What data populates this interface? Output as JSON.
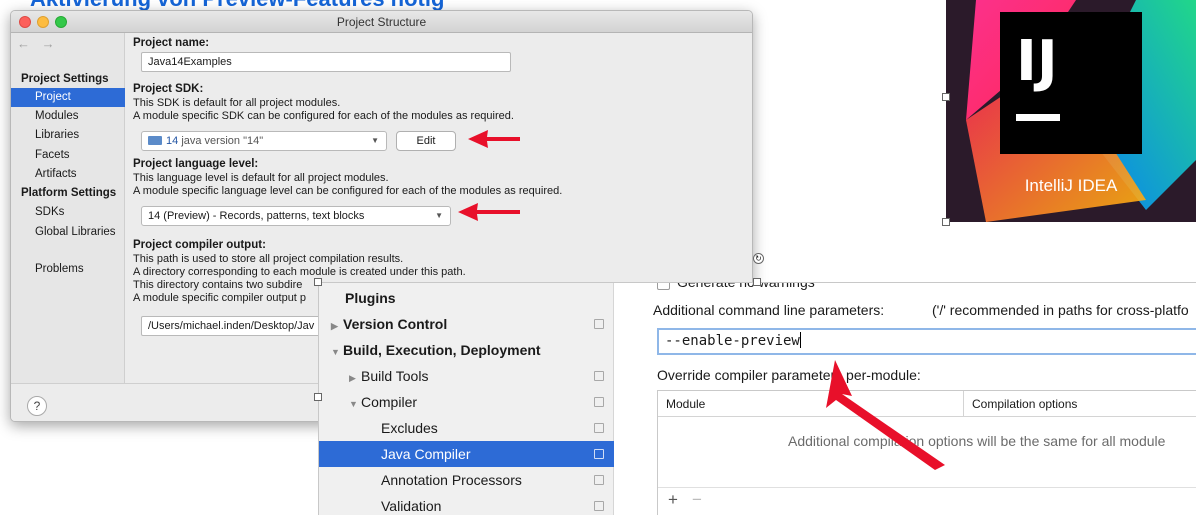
{
  "slide": {
    "title": "Aktivierung von Preview-Features nötig"
  },
  "project_structure": {
    "window_title": "Project Structure",
    "nav_arrows": "← →",
    "sidebar": {
      "project_settings_header": "Project Settings",
      "items": [
        "Project",
        "Modules",
        "Libraries",
        "Facets",
        "Artifacts"
      ],
      "platform_settings_header": "Platform Settings",
      "platform_items": [
        "SDKs",
        "Global Libraries"
      ],
      "problems": "Problems"
    },
    "project_name_label": "Project name:",
    "project_name_value": "Java14Examples",
    "sdk_label": "Project SDK:",
    "sdk_desc1": "This SDK is default for all project modules.",
    "sdk_desc2": "A module specific SDK can be configured for each of the modules as required.",
    "sdk_num": "14",
    "sdk_value": "java version \"14\"",
    "edit_button": "Edit",
    "lang_label": "Project language level:",
    "lang_desc1": "This language level is default for all project modules.",
    "lang_desc2": "A module specific language level can be configured for each of the modules as required.",
    "lang_value": "14 (Preview) - Records, patterns, text blocks",
    "output_label": "Project compiler output:",
    "output_desc1": "This path is used to store all project compilation results.",
    "output_desc2": "A directory corresponding to each module is created under this path.",
    "output_desc3": "This directory contains two subdire",
    "output_desc4": "A module specific compiler output p",
    "output_value": "/Users/michael.inden/Desktop/Jav",
    "help": "?"
  },
  "logo": {
    "letters": "IJ",
    "caption": "IntelliJ IDEA"
  },
  "settings": {
    "tree": [
      {
        "label": "Plugins",
        "bold": true,
        "triangle": "",
        "indent": 0
      },
      {
        "label": "Version Control",
        "bold": true,
        "triangle": "▶",
        "indent": 0
      },
      {
        "label": "Build, Execution, Deployment",
        "bold": true,
        "triangle": "▼",
        "indent": 0
      },
      {
        "label": "Build Tools",
        "bold": false,
        "triangle": "▶",
        "indent": 1
      },
      {
        "label": "Compiler",
        "bold": false,
        "triangle": "▼",
        "indent": 1
      },
      {
        "label": "Excludes",
        "bold": false,
        "triangle": "",
        "indent": 2
      },
      {
        "label": "Java Compiler",
        "bold": false,
        "triangle": "",
        "indent": 2,
        "selected": true
      },
      {
        "label": "Annotation Processors",
        "bold": false,
        "triangle": "",
        "indent": 2
      },
      {
        "label": "Validation",
        "bold": false,
        "triangle": "",
        "indent": 2
      }
    ],
    "generate_warnings": "Generate no warnings",
    "cmd_label": "Additional command line parameters:",
    "cmd_hint": "('/' recommended in paths for cross-platfo",
    "cmd_value": "--enable-preview",
    "override_label": "Override compiler parameters per-module:",
    "table_col_module": "Module",
    "table_col_options": "Compilation options",
    "table_empty": "Additional compilation options will be the same for all module",
    "add": "+",
    "remove": "−"
  },
  "colors": {
    "accent_blue": "#2d6bd6",
    "title_blue": "#1565d8",
    "arrow_red": "#e8102a"
  }
}
